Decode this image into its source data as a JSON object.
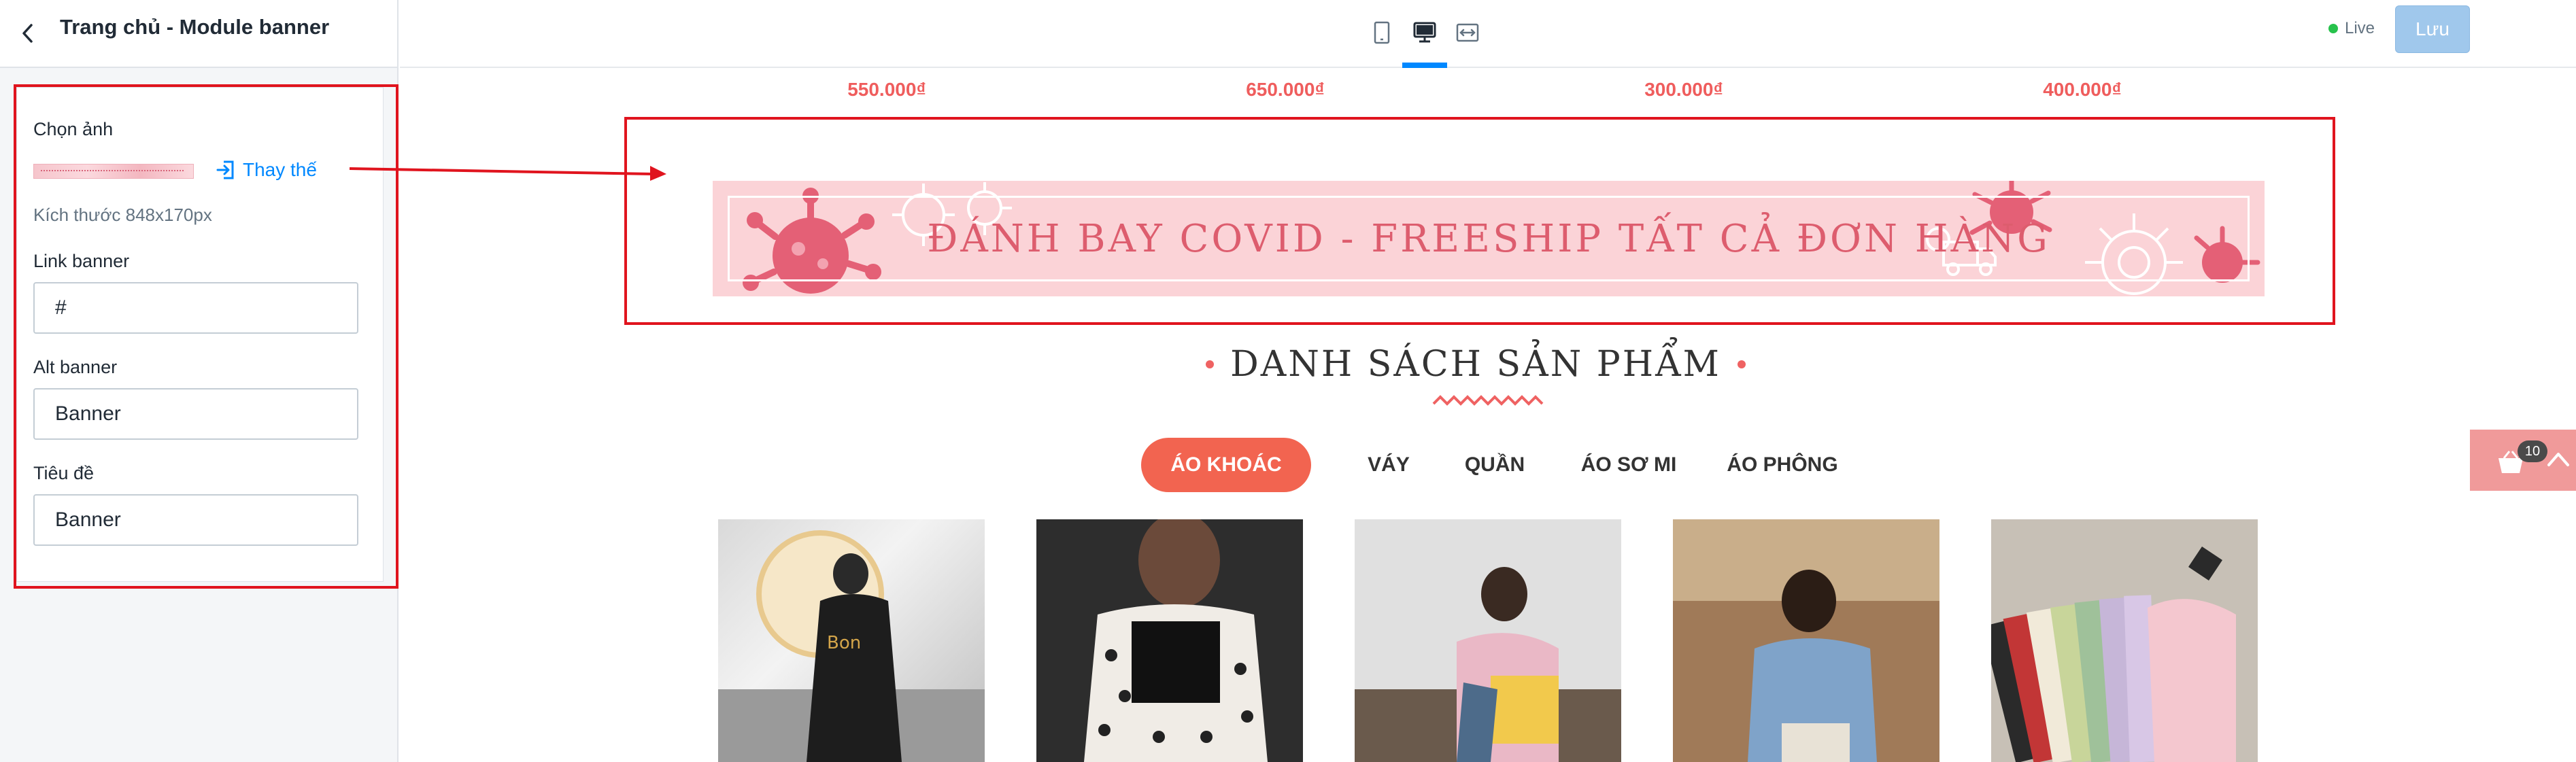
{
  "panel": {
    "title": "Trang chủ - Module banner",
    "choose_image_label": "Chọn ảnh",
    "replace_label": "Thay thế",
    "size_hint": "Kích thước 848x170px",
    "link_label": "Link banner",
    "link_value": "#",
    "alt_label": "Alt banner",
    "alt_value": "Banner",
    "title_label": "Tiêu đề",
    "title_value": "Banner"
  },
  "toolbar": {
    "live_label": "Live",
    "save_label": "Lưu"
  },
  "preview": {
    "prices": [
      "550.000₫",
      "650.000₫",
      "300.000₫",
      "400.000₫"
    ],
    "banner_text": "ĐÁNH BAY COVID - FREESHIP TẤT CẢ ĐƠN HÀNG",
    "section_title": "DANH SÁCH SẢN PHẨM",
    "tabs": [
      "ÁO KHOÁC",
      "VÁY",
      "QUẦN",
      "ÁO SƠ MI",
      "ÁO PHÔNG"
    ],
    "cart_count": "10"
  },
  "colors": {
    "accent_red": "#e0141e",
    "price_red": "#ef5d5d",
    "tab_active": "#f26450",
    "banner_pink": "#fbd3d7",
    "link_blue": "#0088ff"
  }
}
